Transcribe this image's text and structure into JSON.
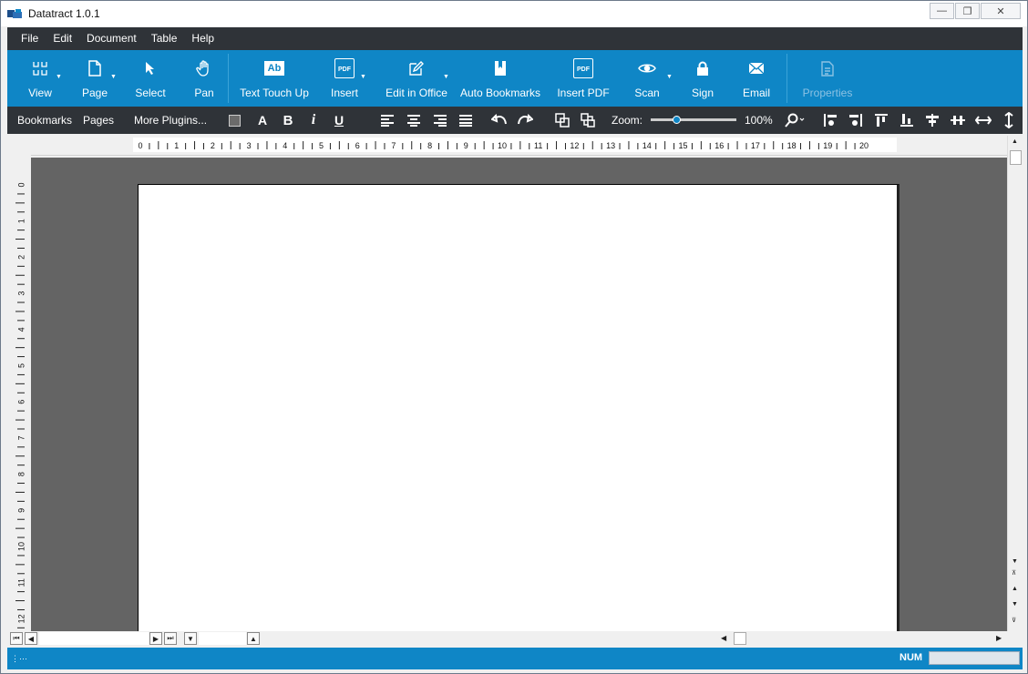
{
  "window": {
    "title": "Datatract 1.0.1",
    "minimize_icon": "minimize-icon",
    "restore_icon": "restore-icon",
    "close_icon": "close-icon"
  },
  "menu": [
    "File",
    "Edit",
    "Document",
    "Table",
    "Help"
  ],
  "ribbon": {
    "view": "View",
    "page": "Page",
    "select": "Select",
    "pan": "Pan",
    "text_touch_up": "Text Touch Up",
    "insert": "Insert",
    "edit_in_office": "Edit in Office",
    "auto_bookmarks": "Auto Bookmarks",
    "insert_pdf": "Insert PDF",
    "scan": "Scan",
    "sign": "Sign",
    "email": "Email",
    "properties": "Properties",
    "pdf_badge": "PDF",
    "ab_badge": "Ab"
  },
  "toolbar": {
    "bookmarks": "Bookmarks",
    "pages": "Pages",
    "more_plugins": "More Plugins...",
    "bold": "B",
    "italic": "i",
    "underline": "U",
    "zoom_label": "Zoom:",
    "zoom_value": "100%",
    "zoom_fraction": 0.3
  },
  "ruler": {
    "h_labels": [
      "0",
      "1",
      "2",
      "3",
      "4",
      "5",
      "6",
      "7",
      "8",
      "9",
      "10",
      "11",
      "12",
      "13",
      "14",
      "15",
      "16",
      "17",
      "18",
      "19",
      "20"
    ],
    "v_labels": [
      "0",
      "1",
      "2",
      "3",
      "4",
      "5",
      "6",
      "7",
      "8",
      "9",
      "10",
      "11",
      "12"
    ]
  },
  "status": {
    "num": "NUM"
  },
  "colors": {
    "ribbon": "#0f86c6",
    "menubar": "#2f3338",
    "canvas": "#646464"
  }
}
